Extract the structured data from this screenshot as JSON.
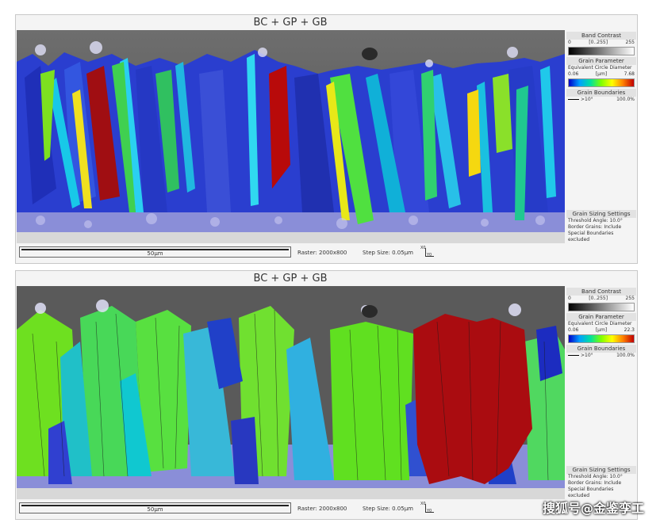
{
  "panels": [
    {
      "title": "BC + GP + GB",
      "legend": {
        "band_contrast": {
          "title": "Band Contrast",
          "min": "0",
          "range": "[0..255]",
          "max": "255"
        },
        "grain_parameter": {
          "title": "Grain Parameter",
          "subtitle": "Equivalent Circle Diameter",
          "min": "0.06",
          "unit": "[µm]",
          "max": "7.68"
        },
        "grain_boundaries": {
          "title": "Grain Boundaries",
          "entry": ">10°",
          "pct": "100.0%"
        },
        "sizing": {
          "title": "Grain Sizing Settings",
          "lines": [
            "Threshold Angle: 10.0°",
            "Border Grains: Include",
            "Special Boundaries excluded"
          ]
        }
      },
      "footer": {
        "scale": "50µm",
        "raster": "Raster: 2000x800",
        "step": "Step Size: 0.05µm"
      }
    },
    {
      "title": "BC + GP + GB",
      "legend": {
        "band_contrast": {
          "title": "Band Contrast",
          "min": "0",
          "range": "[0..255]",
          "max": "255"
        },
        "grain_parameter": {
          "title": "Grain Parameter",
          "subtitle": "Equivalent Circle Diameter",
          "min": "0.06",
          "unit": "[µm]",
          "max": "22.3"
        },
        "grain_boundaries": {
          "title": "Grain Boundaries",
          "entry": ">10°",
          "pct": "100.0%"
        },
        "sizing": {
          "title": "Grain Sizing Settings",
          "lines": [
            "Threshold Angle: 10.0°",
            "Border Grains: Include",
            "Special Boundaries excluded"
          ]
        }
      },
      "footer": {
        "scale": "50µm",
        "raster": "Raster: 2000x800",
        "step": "Step Size: 0.05µm"
      }
    }
  ],
  "axes_labels": {
    "x": "X0",
    "y": "Y0"
  },
  "watermark": "搜狐号@金鉴孪工"
}
